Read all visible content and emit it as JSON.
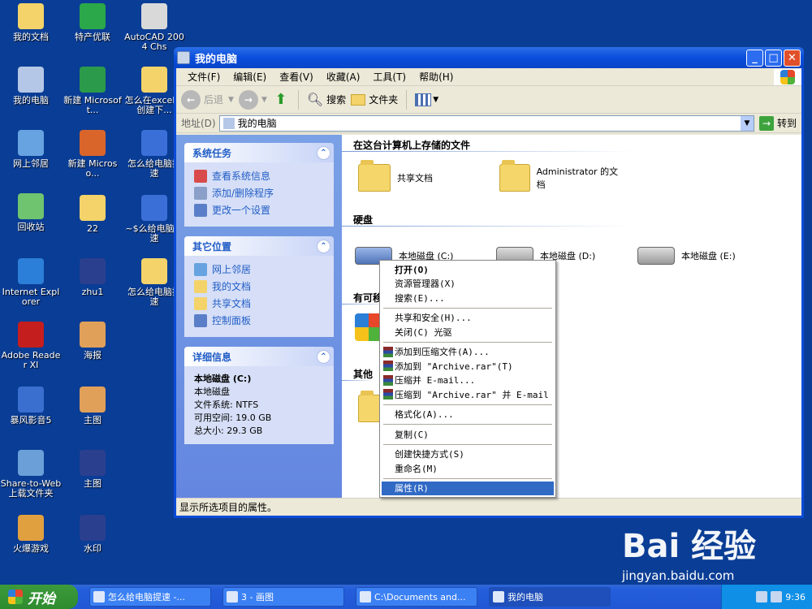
{
  "desktop": {
    "icons": [
      {
        "label": "我的文档",
        "color": "#f3d36a"
      },
      {
        "label": "特产优联",
        "color": "#2aa84a"
      },
      {
        "label": "AutoCAD 2004 Chs",
        "color": "#d9d9d9"
      },
      {
        "label": "我的电脑",
        "color": "#b5c7e6"
      },
      {
        "label": "新建 Microsoft...",
        "color": "#2b9a4b"
      },
      {
        "label": "怎么在excel中创建下...",
        "color": "#f3d36a"
      },
      {
        "label": "网上邻居",
        "color": "#66a3e0"
      },
      {
        "label": "新建 Microso...",
        "color": "#d9652b"
      },
      {
        "label": "怎么给电脑提速",
        "color": "#3b6fd8"
      },
      {
        "label": "回收站",
        "color": "#6fc46f"
      },
      {
        "label": "22",
        "color": "#f3d36a"
      },
      {
        "label": "~$么给电脑提速",
        "color": "#3b6fd8"
      },
      {
        "label": "Internet Explorer",
        "color": "#2c7fd8"
      },
      {
        "label": "zhu1",
        "color": "#2b3f8f"
      },
      {
        "label": "怎么给电脑提速",
        "color": "#f3d36a"
      },
      {
        "label": "Adobe Reader XI",
        "color": "#c41e1e"
      },
      {
        "label": "海报",
        "color": "#e0a05a"
      },
      {
        "label": "暴风影音5",
        "color": "#3a6fd0"
      },
      {
        "label": "主图",
        "color": "#e0a05a"
      },
      {
        "label": "Share-to-Web上载文件夹",
        "color": "#6a9fd8"
      },
      {
        "label": "主图",
        "color": "#2b3f8f"
      },
      {
        "label": "火爆游戏",
        "color": "#e0a040"
      },
      {
        "label": "水印",
        "color": "#2b3f8f"
      }
    ]
  },
  "window": {
    "title": "我的电脑",
    "menu": [
      "文件(F)",
      "编辑(E)",
      "查看(V)",
      "收藏(A)",
      "工具(T)",
      "帮助(H)"
    ],
    "toolbar": {
      "back": "后退",
      "search": "搜索",
      "folders": "文件夹"
    },
    "address": {
      "label": "地址(D)",
      "value": "我的电脑",
      "go": "转到"
    },
    "tasks_panel": {
      "title": "系统任务",
      "links": [
        "查看系统信息",
        "添加/删除程序",
        "更改一个设置"
      ]
    },
    "places_panel": {
      "title": "其它位置",
      "links": [
        "网上邻居",
        "我的文档",
        "共享文档",
        "控制面板"
      ]
    },
    "details_panel": {
      "title": "详细信息",
      "name": "本地磁盘 (C:)",
      "type": "本地磁盘",
      "fs": "文件系统: NTFS",
      "free": "可用空间: 19.0 GB",
      "total": "总大小: 29.3 GB"
    },
    "content": {
      "section_files": "在这台计算机上存储的文件",
      "shared_docs": "共享文档",
      "admin_docs": "Administrator 的文档",
      "section_disks": "硬盘",
      "disk_c": "本地磁盘 (C:)",
      "disk_d": "本地磁盘 (D:)",
      "disk_e": "本地磁盘 (E:)",
      "section_removable": "有可移",
      "section_other": "其他"
    },
    "status": "显示所选项目的属性。"
  },
  "context_menu": {
    "open": "打开(O)",
    "explorer": "资源管理器(X)",
    "search": "搜索(E)...",
    "sharing": "共享和安全(H)...",
    "close_drive": "关闭(C) 光驱",
    "add_archive": "添加到压缩文件(A)...",
    "add_rar": "添加到 \"Archive.rar\"(T)",
    "compress_email": "压缩并 E-mail...",
    "compress_rar_email": "压缩到 \"Archive.rar\" 并 E-mail",
    "format": "格式化(A)...",
    "copy": "复制(C)",
    "shortcut": "创建快捷方式(S)",
    "rename": "重命名(M)",
    "properties": "属性(R)"
  },
  "taskbar": {
    "start": "开始",
    "tasks": [
      "怎么给电脑提速 -...",
      "3 - 画图",
      "C:\\Documents and...",
      "我的电脑"
    ],
    "clock": "9:36"
  },
  "watermark": {
    "logo": "Bai 经验",
    "url": "jingyan.baidu.com"
  }
}
